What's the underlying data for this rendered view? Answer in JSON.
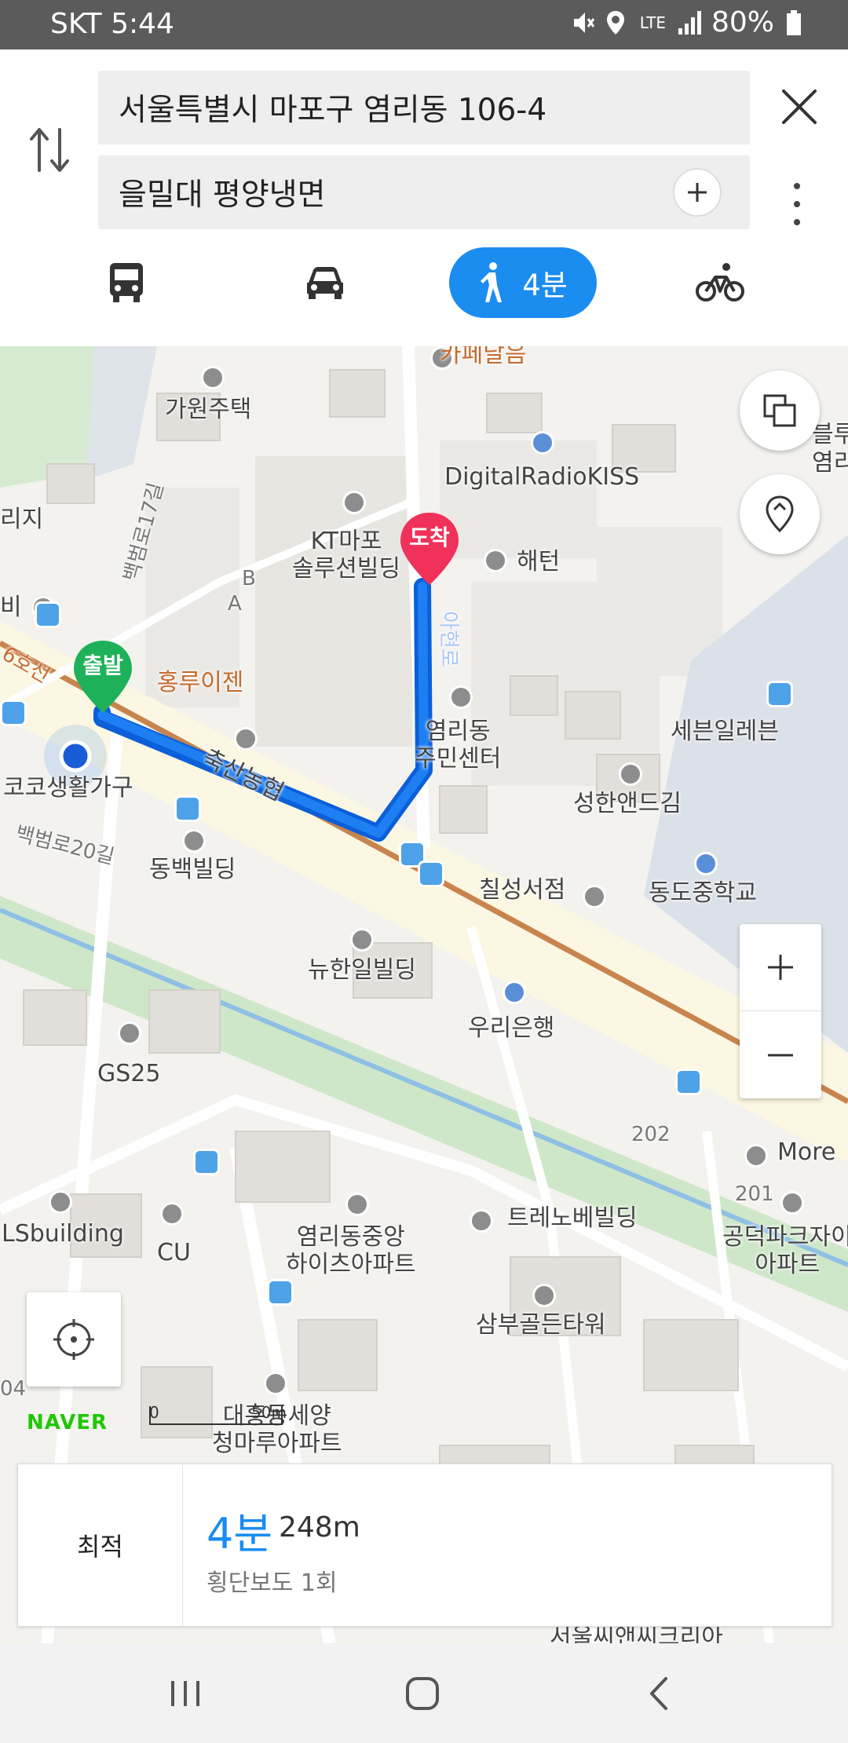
{
  "status_bar": {
    "carrier_time": "SKT 5:44",
    "network": "LTE",
    "battery": "80%"
  },
  "route_search": {
    "origin": "서울특별시 마포구 염리동 106-4",
    "destination": "을밀대 평양냉면"
  },
  "transport_modes": {
    "selected": "walk",
    "walk_label": "4분",
    "accent_color": "#1b8cf0"
  },
  "map": {
    "start_pin": "출발",
    "end_pin": "도착",
    "brand": "NAVER",
    "scale_zero": "0",
    "scale_distance": "50m",
    "labels": {
      "cafe": "카페달음",
      "gawon": "가원주택",
      "radio": "DigitalRadioKISS",
      "kt": "KT마포\n솔루션빌딩",
      "haeteon": "해턴",
      "hongru": "홍루이젠",
      "seven": "세븐일레븐",
      "yeomni_center": "염리동\n주민센터",
      "seonghan": "성한앤드김",
      "chuksan": "축산농협",
      "coco": "코코생활가구",
      "dongbaek": "동백빌딩",
      "chilseong": "칠성서점",
      "dongdo": "동도중학교",
      "nyuhanil": "뉴한일빌딩",
      "woori": "우리은행",
      "gs25": "GS25",
      "more": "More",
      "yeomni_apt": "염리동중앙\n하이츠아파트",
      "treno": "트레노베빌딩",
      "gongdeok": "공덕파크자이\n아파트",
      "ls": "LSbuilding",
      "cu": "CU",
      "sambu": "삼부골든타워",
      "daeheung": "대흥동세양\n청마루아파트",
      "road_17": "백범로17길",
      "road_20": "백범로20길",
      "line_6": "6호선",
      "num_202": "202",
      "num_201": "201",
      "bldg_b": "B",
      "bldg_a": "A",
      "left_ji": "리지",
      "left_bi": "비",
      "right_1": "블루",
      "right_2": "염리",
      "seoul_bottom": "서울씨앤씨크리아",
      "left_04": "04",
      "route_road": "아현로"
    }
  },
  "summary": {
    "best_label": "최적",
    "duration": "4분",
    "distance": "248m",
    "crosswalk": "횡단보도 1회"
  }
}
